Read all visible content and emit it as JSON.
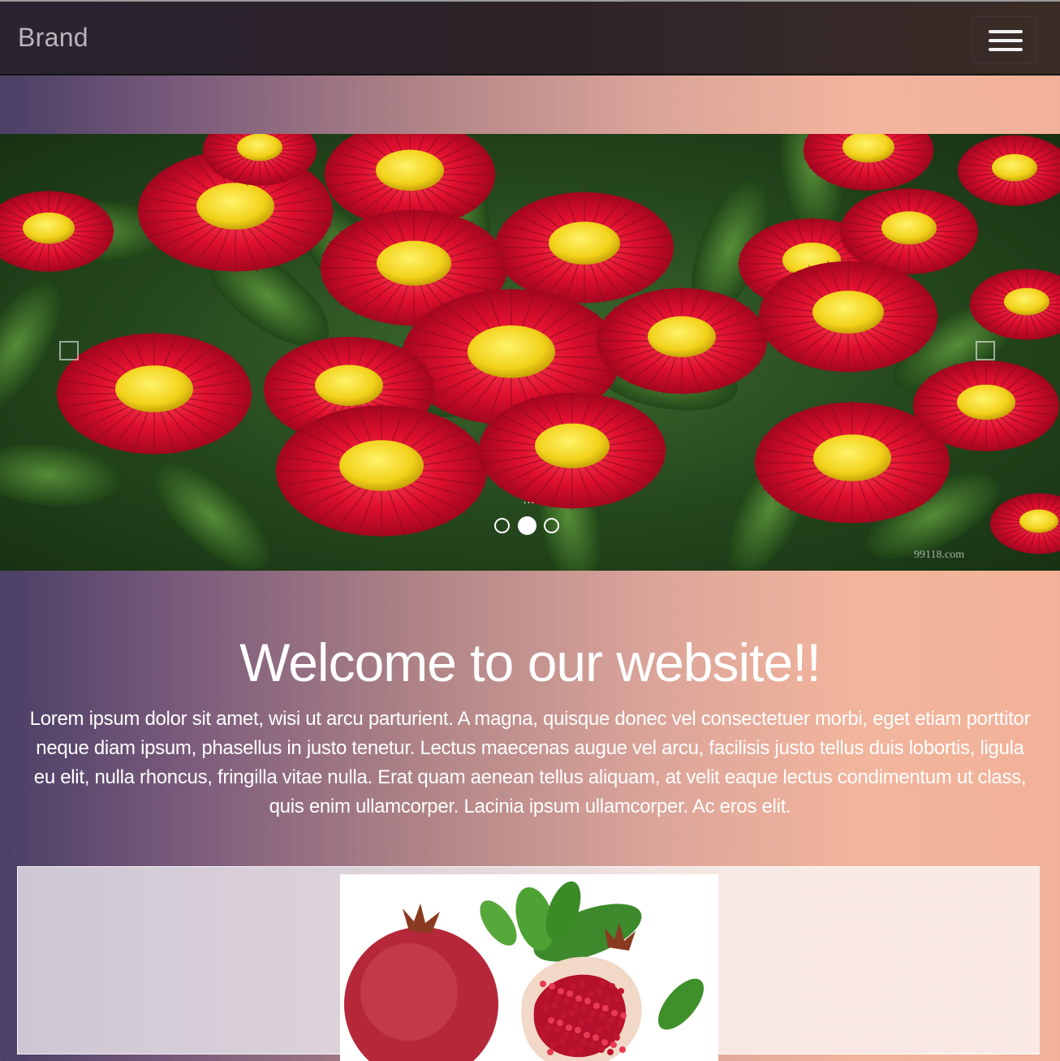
{
  "navbar": {
    "brand": "Brand",
    "menu_icon": "hamburger-icon"
  },
  "carousel": {
    "slide_image": "red daisy flowers",
    "watermark": "99118.com",
    "ellipsis": "...",
    "prev_icon": "square-outline-icon",
    "next_icon": "square-outline-icon",
    "indicators": 3,
    "active_indicator": 2
  },
  "main": {
    "title": "Welcome to our website!!",
    "lead": "Lorem ipsum dolor sit amet, wisi ut arcu parturient. A magna, quisque donec vel consectetuer morbi, eget etiam porttitor neque diam ipsum, phasellus in justo tenetur. Lectus maecenas augue vel arcu, facilisis justo tellus duis lobortis, ligula eu elit, nulla rhoncus, fringilla vitae nulla. Erat quam aenean tellus aliquam, at velit eaque lectus condimentum ut class, quis enim ullamcorper. Lacinia ipsum ullamcorper. Ac eros elit."
  },
  "panel": {
    "image": "pomegranate"
  },
  "colors": {
    "navbar": "#2d2328",
    "gradient_start": "#4a3f66",
    "gradient_end": "#f2b29a",
    "text": "#ffffff"
  }
}
